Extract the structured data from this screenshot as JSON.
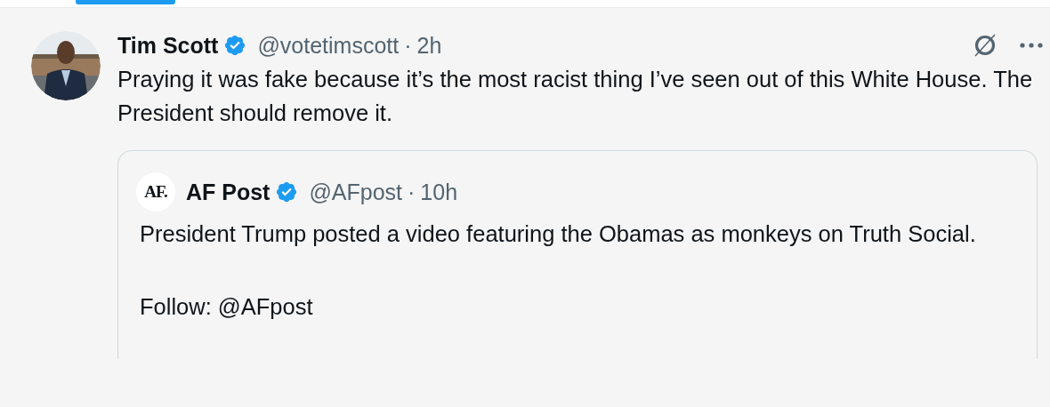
{
  "post": {
    "author": "Tim Scott",
    "verified": true,
    "handle": "@votetimscott",
    "separator": "·",
    "time": "2h",
    "text": "Praying it was fake because it’s the most racist thing I’ve seen out of this White House. The President should remove it."
  },
  "quote": {
    "logo": "AF.",
    "author": "AF Post",
    "verified": true,
    "handle": "@AFpost",
    "separator": "·",
    "time": "10h",
    "paragraphs": [
      "President Trump posted a video featuring the Obamas as monkeys on Truth Social.",
      "Follow: @AFpost"
    ]
  }
}
